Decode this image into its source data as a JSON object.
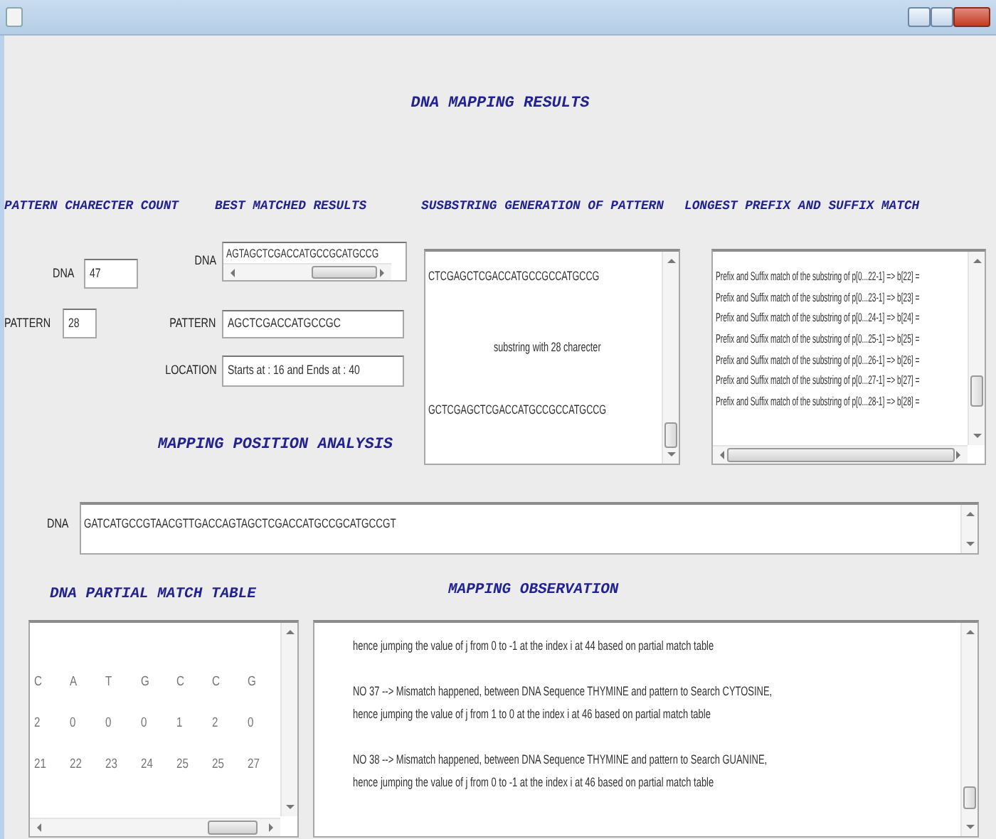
{
  "title": "DNA MAPPING RESULTS",
  "character_count": {
    "heading": "PATTERN CHARECTER COUNT",
    "fields": [
      {
        "label": "DNA",
        "value": "47"
      },
      {
        "label": "PATTERN",
        "value": "28"
      }
    ]
  },
  "best_matched": {
    "heading": "BEST MATCHED RESULTS",
    "fields": [
      {
        "label": "DNA",
        "value": "AGTAGCTCGACCATGCCGCATGCCG",
        "kind": "scroll"
      },
      {
        "label": "PATTERN",
        "value": "AGCTCGACCATGCCGC",
        "kind": "text"
      },
      {
        "label": "LOCATION",
        "value": "Starts at :  16 and  Ends at : 40",
        "kind": "text"
      }
    ]
  },
  "substring_generation": {
    "heading": "SUSBSTRING GENERATION OF PATTERN",
    "lines": [
      {
        "text": "CTCGAGCTCGACCATGCCGCCATGCCG",
        "kind": "sequence"
      },
      {
        "text": "substring with 28 charecter",
        "kind": "caption"
      },
      {
        "text": "GCTCGAGCTCGACCATGCCGCCATGCCG",
        "kind": "sequence"
      }
    ]
  },
  "prefix_suffix": {
    "heading": "LONGEST PREFIX AND SUFFIX MATCH",
    "lines": [
      "Prefix and Suffix match of the substring of p[0...22-1] => b[22] =",
      "Prefix and Suffix match of the substring of p[0...23-1] => b[23] =",
      "Prefix and Suffix match of the substring of p[0...24-1] => b[24] =",
      "Prefix and Suffix match of the substring of p[0...25-1] => b[25] =",
      "Prefix and Suffix match of the substring of p[0...26-1] => b[26] =",
      "Prefix and Suffix match of the substring of p[0...27-1] => b[27] =",
      "Prefix and Suffix match of the substring of p[0...28-1] => b[28] ="
    ]
  },
  "mapping_position": {
    "heading": "MAPPING POSITION ANALYSIS",
    "label": "DNA",
    "value": "GATCATGCCGTAACGTTGACCAGTAGCTCGACCATGCCGCATGCCGT"
  },
  "partial_match_table": {
    "heading": "DNA PARTIAL MATCH TABLE",
    "rows": [
      [
        "C",
        "A",
        "T",
        "G",
        "C",
        "C",
        "G"
      ],
      [
        "2",
        "0",
        "0",
        "0",
        "1",
        "2",
        "0"
      ],
      [
        "21",
        "22",
        "23",
        "24",
        "25",
        "25",
        "27"
      ]
    ]
  },
  "observation": {
    "heading": "MAPPING OBSERVATION",
    "paragraphs": [
      [
        "hence jumping the value of j from 0 to -1 at the index i at 44 based on partial match table"
      ],
      [
        "NO 37 --> Mismatch happened, between DNA Sequence THYMINE and pattern to Search CYTOSINE,",
        "hence jumping the value of j from 1 to 0 at the index i at 46 based on partial match table"
      ],
      [
        "NO 38 --> Mismatch happened, between DNA Sequence THYMINE and pattern to Search GUANINE,",
        "hence jumping the value of j from 0 to -1 at the index i at 46 based on partial match table"
      ]
    ]
  }
}
